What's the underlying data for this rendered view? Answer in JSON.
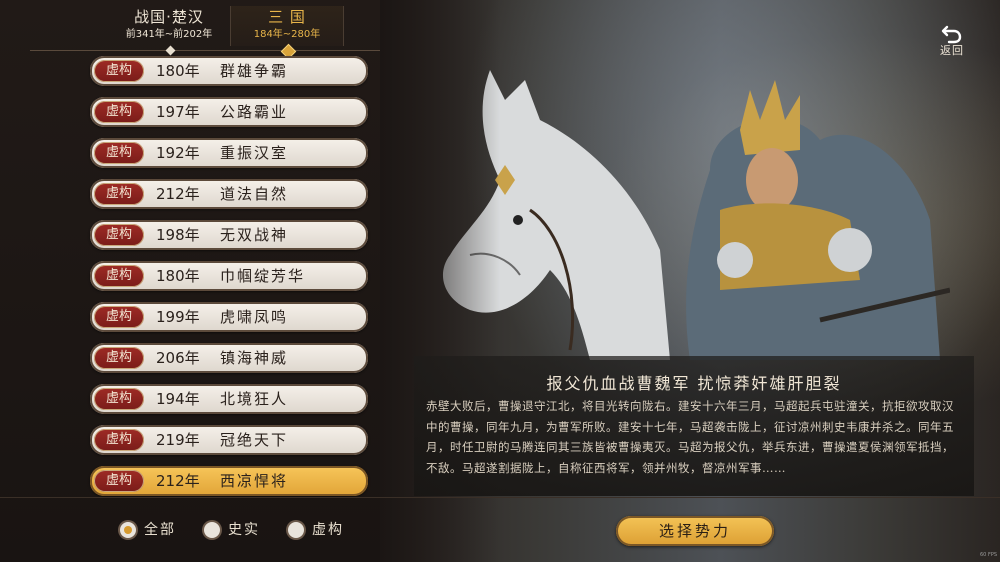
{
  "eras": [
    {
      "name": "战国·楚汉",
      "range": "前341年~前202年"
    },
    {
      "name": "三 国",
      "range": "184年~280年"
    }
  ],
  "scenarios": [
    {
      "badge": "虚构",
      "year": "180年",
      "title": "群雄争霸"
    },
    {
      "badge": "虚构",
      "year": "197年",
      "title": "公路霸业"
    },
    {
      "badge": "虚构",
      "year": "192年",
      "title": "重振汉室"
    },
    {
      "badge": "虚构",
      "year": "212年",
      "title": "道法自然"
    },
    {
      "badge": "虚构",
      "year": "198年",
      "title": "无双战神"
    },
    {
      "badge": "虚构",
      "year": "180年",
      "title": "巾帼绽芳华"
    },
    {
      "badge": "虚构",
      "year": "199年",
      "title": "虎啸凤鸣"
    },
    {
      "badge": "虚构",
      "year": "206年",
      "title": "镇海神威"
    },
    {
      "badge": "虚构",
      "year": "194年",
      "title": "北境狂人"
    },
    {
      "badge": "虚构",
      "year": "219年",
      "title": "冠绝天下"
    },
    {
      "badge": "虚构",
      "year": "212年",
      "title": "西凉悍将"
    }
  ],
  "filters": {
    "all": "全部",
    "historical": "史实",
    "fictional": "虚构"
  },
  "back_label": "返回",
  "story": {
    "title": "报父仇血战曹魏军 扰惊莽奸雄肝胆裂",
    "body": "赤壁大败后，曹操退守江北，将目光转向陇右。建安十六年三月，马超起兵屯驻潼关，抗拒欲攻取汉中的曹操，同年九月，为曹军所败。建安十七年，马超袭击陇上，征讨凉州刺史韦康并杀之。同年五月，时任卫尉的马腾连同其三族皆被曹操夷灭。马超为报父仇，举兵东进，曹操遣夏侯渊领军抵挡，不敌。马超遂割据陇上，自称征西将军，领并州牧，督凉州军事……"
  },
  "select_button": "选择势力",
  "fps": "60 FPS",
  "colors": {
    "accent_gold": "#e8b54a",
    "badge_red": "#8c2520",
    "selected_row": "#f0b848"
  }
}
